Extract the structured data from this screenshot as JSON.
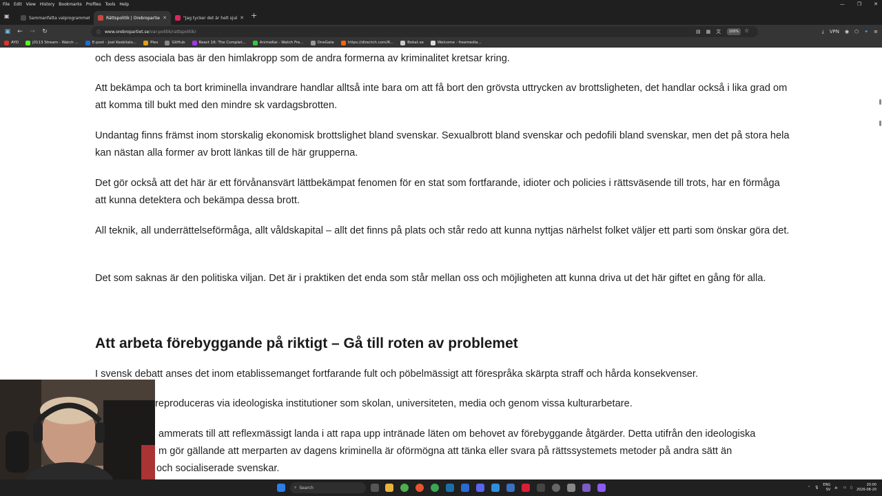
{
  "menu": [
    "File",
    "Edit",
    "View",
    "History",
    "Bookmarks",
    "Profiles",
    "Tools",
    "Help"
  ],
  "tabs": [
    {
      "title": "Sammanfatta valprogrammet",
      "active": false,
      "color": "#4a4a4a"
    },
    {
      "title": "Rättspolitik | Örebropartiet",
      "active": true,
      "color": "#c84a3e"
    },
    {
      "title": "\"Jag tycker det är helt sjukt att",
      "active": false,
      "color": "#e0245e"
    }
  ],
  "address": {
    "domain": "www.orebropartiet.se",
    "path": "/var-politik/rattspolitik/"
  },
  "zoom": "100%",
  "vpn_label": "VPN",
  "bookmarks": [
    {
      "label": "AYD",
      "color": "#d33"
    },
    {
      "label": "j0113 Stream - Watch ...",
      "color": "#53fc18"
    },
    {
      "label": "E-post - Joel Keskitalo...",
      "color": "#1e6bd6"
    },
    {
      "label": "Plex",
      "color": "#e5a00d"
    },
    {
      "label": "GitHub",
      "color": "#888"
    },
    {
      "label": "React 16: The Complet...",
      "color": "#a435f0"
    },
    {
      "label": "AnimeKai - Watch Fre...",
      "color": "#3c3"
    },
    {
      "label": "OneGate",
      "color": "#999"
    },
    {
      "label": "https://directch.com/R...",
      "color": "#f60"
    },
    {
      "label": "Bokat.se",
      "color": "#ccc"
    },
    {
      "label": "Welcome - freemedia...",
      "color": "#ddd"
    }
  ],
  "article": {
    "p0": "och dess asociala bas är den himlakropp som de andra formerna av kriminalitet kretsar kring.",
    "p1": "Att bekämpa och ta bort kriminella invandrare handlar alltså inte bara om att få bort den grövsta uttrycken av brottsligheten, det handlar också i lika grad om att komma till bukt med den mindre sk vardagsbrotten.",
    "p2": "Undantag finns främst inom storskalig ekonomisk brottslighet bland svenskar. Sexualbrott bland svenskar och pedofili bland svenskar, men det på stora hela kan nästan alla former av brott länkas till de här grupperna.",
    "p3": "Det gör också att det här är ett förvånansvärt lättbekämpat fenomen för en stat som fortfarande, idioter och policies i rättsväsende till trots, har en förmåga att kunna detektera och bekämpa dessa brott.",
    "p4": "All teknik, all underrättelseförmåga, allt våldskapital – allt det finns på plats och står redo att kunna nyttjas närhelst folket väljer ett parti som önskar göra det.",
    "p5": "Det som saknas är den politiska viljan. Det är i praktiken det enda som står mellan oss och möjligheten att kunna driva ut det här giftet en gång för alla.",
    "heading": "Att arbeta förebyggande på riktigt – Gå till roten av problemet",
    "p6": "I svensk debatt anses det inom etablissemanget fortfarande fult och pöbelmässigt att förespråka skärpta straff och hårda konsekvenser.",
    "p7": "reproduceras via ideologiska institutioner som skolan, universiteten, media och genom vissa kulturarbetare.",
    "p8": "ammerats till att reflexmässigt landa i att rapa upp intränade läten om behovet av förebyggande åtgärder. Detta utifrån den ideologiska",
    "p9": "m gör gällande att merparten av dagens kriminella är oförmögna att tänka eller svara på rättssystemets metoder på andra sätt än",
    "p10": "och socialiserade svenskar."
  },
  "taskbar": {
    "search_placeholder": "Search"
  },
  "tray": {
    "lang": "ENG",
    "region": "SV",
    "time": "20:00",
    "date": "2026-08-20"
  }
}
